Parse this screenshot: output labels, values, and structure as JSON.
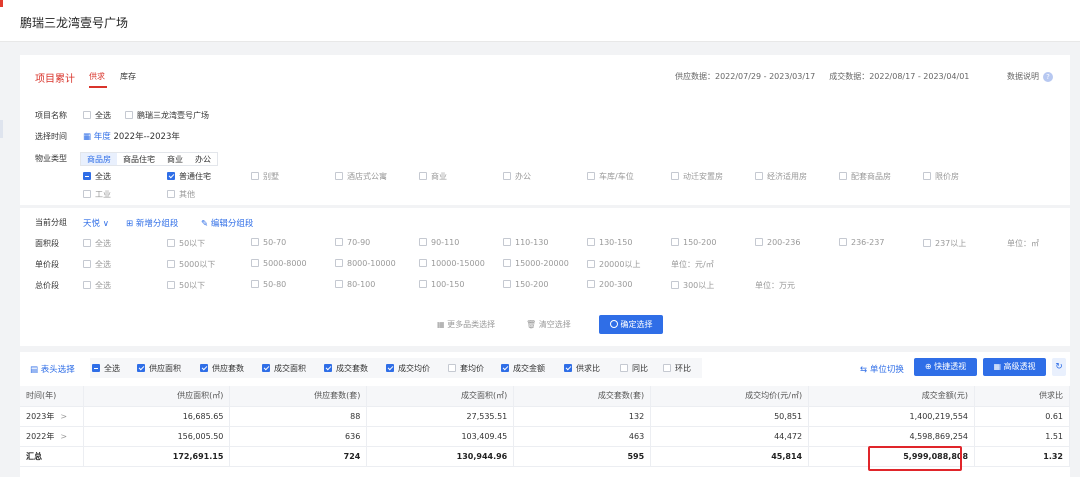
{
  "page": {
    "title": "鹏瑞三龙湾壹号广场"
  },
  "header": {
    "title": "项目累计",
    "tabs": [
      "供求",
      "库存"
    ],
    "supply_data": "供应数据：2022/07/29 - 2023/03/17",
    "deal_data": "成交数据：2022/08/17 - 2023/04/01",
    "note": "数据说明"
  },
  "filters": {
    "project": {
      "label": "项目名称",
      "all": "全选",
      "option": "鹏瑞三龙湾壹号广场"
    },
    "time": {
      "label": "选择时间",
      "mode": "年度",
      "range": "2022年--2023年"
    },
    "property": {
      "label": "物业类型",
      "tabs": [
        "商品房",
        "商品住宅",
        "商业",
        "办公"
      ],
      "row1": [
        "全选",
        "普通住宅",
        "别墅",
        "酒店式公寓",
        "商业",
        "办公",
        "车库/车位",
        "动迁安置房",
        "经济适用房",
        "配套商品房",
        "限价房"
      ],
      "row2": [
        "工业",
        "其他"
      ]
    }
  },
  "grouping": {
    "label": "当前分组",
    "current": "天悦",
    "add": "新增分组段",
    "edit": "编辑分组段",
    "area": {
      "label": "面积段",
      "items": [
        "全选",
        "50以下",
        "50-70",
        "70-90",
        "90-110",
        "110-130",
        "130-150",
        "150-200",
        "200-236",
        "236-237",
        "237以上"
      ],
      "unit": "单位：㎡"
    },
    "price": {
      "label": "单价段",
      "items": [
        "全选",
        "5000以下",
        "5000-8000",
        "8000-10000",
        "10000-15000",
        "15000-20000",
        "20000以上"
      ],
      "unit": "单位：元/㎡"
    },
    "total": {
      "label": "总价段",
      "items": [
        "全选",
        "50以下",
        "50-80",
        "80-100",
        "100-150",
        "150-200",
        "200-300",
        "300以上"
      ],
      "unit": "单位：万元"
    }
  },
  "actions": {
    "more": "更多品类选择",
    "clear": "清空选择",
    "confirm": "确定选择"
  },
  "columns_bar": {
    "label": "表头选择",
    "items": [
      "全选",
      "供应面积",
      "供应套数",
      "成交面积",
      "成交套数",
      "成交均价",
      "套均价",
      "成交金额",
      "供求比",
      "同比",
      "环比"
    ],
    "checked": [
      true,
      true,
      true,
      true,
      true,
      true,
      false,
      true,
      true,
      false,
      false
    ],
    "unit_switch": "单位切换",
    "quick": "快捷透视",
    "advanced": "高级透视"
  },
  "table": {
    "headers": [
      "时间(年)",
      "供应面积(㎡)",
      "供应套数(套)",
      "成交面积(㎡)",
      "成交套数(套)",
      "成交均价(元/㎡)",
      "成交金额(元)",
      "供求比"
    ],
    "rows": [
      [
        "2023年",
        "16,685.65",
        "88",
        "27,535.51",
        "132",
        "50,851",
        "1,400,219,554",
        "0.61"
      ],
      [
        "2022年",
        "156,005.50",
        "636",
        "103,409.45",
        "463",
        "44,472",
        "4,598,869,254",
        "1.51"
      ]
    ],
    "summary": [
      "汇总",
      "172,691.15",
      "724",
      "130,944.96",
      "595",
      "45,814",
      "5,999,088,808",
      "1.32"
    ]
  },
  "colors": {
    "accent": "#2f6ee7",
    "brand_red": "#d9342b",
    "highlight": "#e0252a"
  }
}
